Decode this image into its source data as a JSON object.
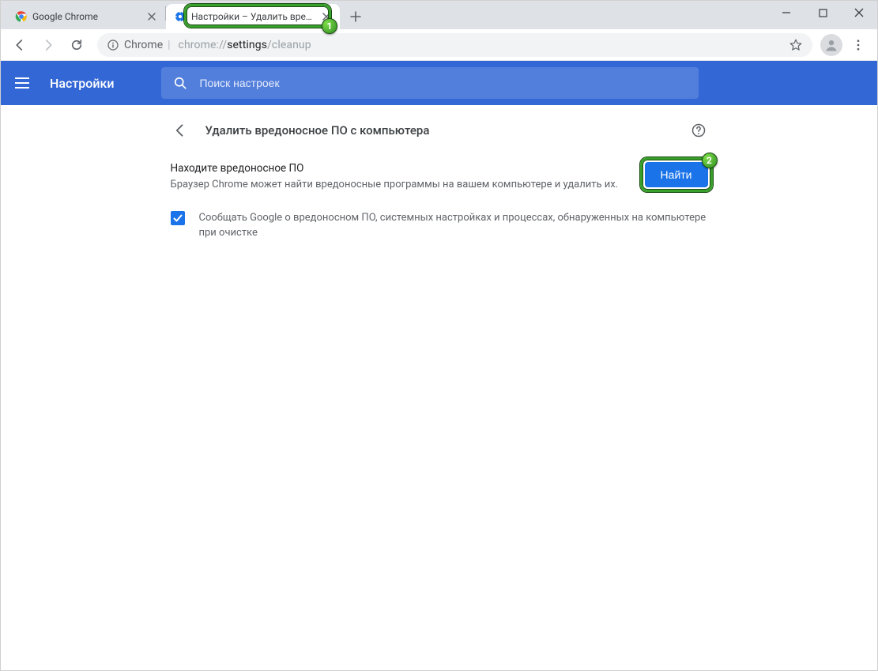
{
  "window": {
    "tabs": [
      {
        "title": "Google Chrome",
        "active": false
      },
      {
        "title": "Настройки – Удалить вредоносное ПО",
        "active": true
      }
    ]
  },
  "toolbar": {
    "site_label": "Chrome",
    "url_dim_prefix": "chrome://",
    "url_dark": "settings",
    "url_dim_suffix": "/cleanup"
  },
  "settings_header": {
    "title": "Настройки",
    "search_placeholder": "Поиск настроек"
  },
  "section": {
    "title": "Удалить вредоносное ПО с компьютера",
    "row_title": "Находите вредоносное ПО",
    "row_desc": "Браузер Chrome может найти вредоносные программы на вашем компьютере и удалить их.",
    "button_label": "Найти",
    "checkbox_label": "Сообщать Google о вредоносном ПО, системных настройках и процессах, обнаруженных на компьютере при очистке",
    "checkbox_checked": true
  },
  "annotations": {
    "badge1": "1",
    "badge2": "2"
  }
}
